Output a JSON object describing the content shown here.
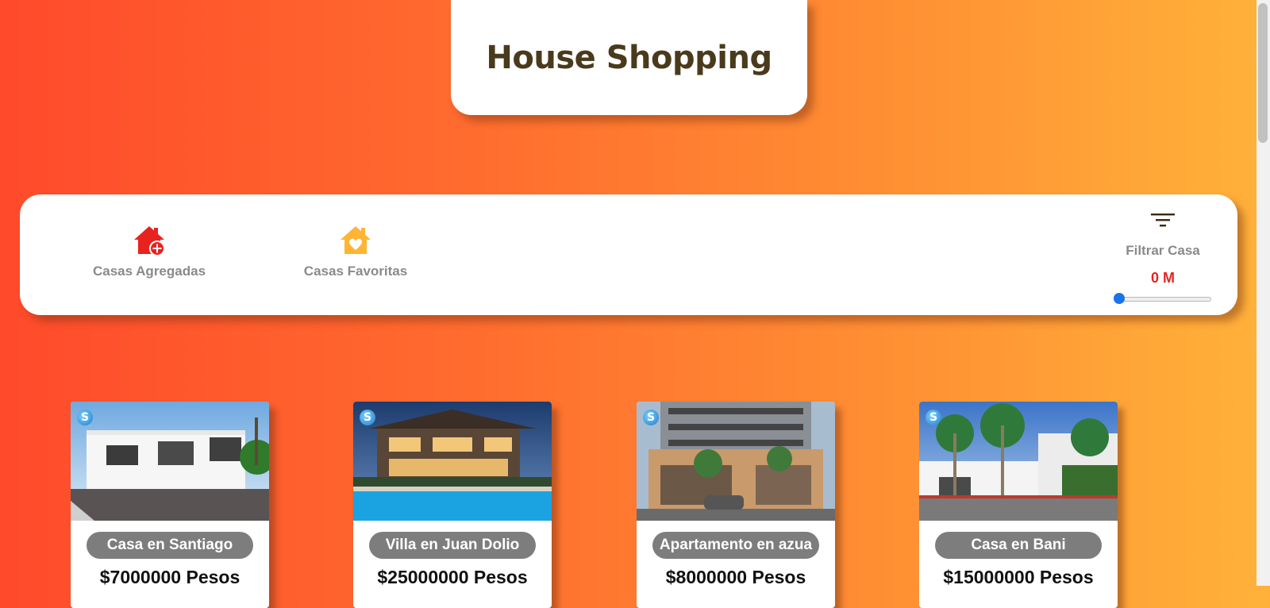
{
  "header": {
    "title": "House Shopping"
  },
  "toolbar": {
    "added_label": "Casas Agregadas",
    "favorites_label": "Casas Favoritas",
    "filter_label": "Filtrar Casa",
    "filter_value": "0 M",
    "filter_slider_level": 0
  },
  "listings": [
    {
      "name": "Casa en Santiago",
      "price": "$7000000 Pesos"
    },
    {
      "name": "Villa en Juan Dolio",
      "price": "$25000000 Pesos"
    },
    {
      "name": "Apartamento en azua",
      "price": "$8000000 Pesos"
    },
    {
      "name": "Casa en Bani",
      "price": "$15000000 Pesos"
    }
  ],
  "colors": {
    "accent_red": "#e8231f",
    "accent_yellow": "#ffb433",
    "title_text": "#4a3a1c",
    "slider_thumb": "#1a73e8"
  },
  "icons": [
    "house-add-icon",
    "house-heart-icon",
    "filter-icon",
    "brand-logo-icon"
  ]
}
